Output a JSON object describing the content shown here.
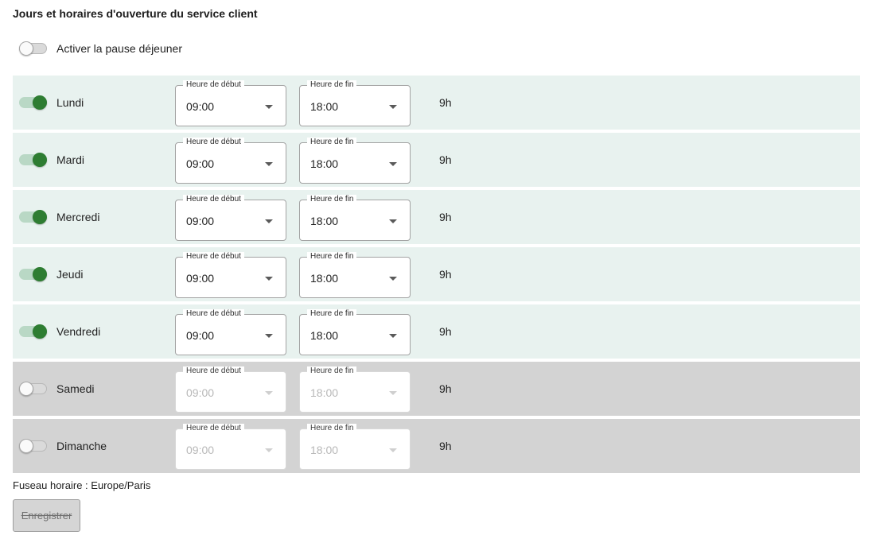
{
  "header": {
    "title": "Jours et horaires d'ouverture du service client"
  },
  "lunch_break": {
    "label": "Activer la pause déjeuner",
    "enabled": false
  },
  "days": [
    {
      "name": "Lundi",
      "enabled": true,
      "start_label": "Heure de début",
      "start": "09:00",
      "end_label": "Heure de fin",
      "end": "18:00",
      "duration": "9h"
    },
    {
      "name": "Mardi",
      "enabled": true,
      "start_label": "Heure de début",
      "start": "09:00",
      "end_label": "Heure de fin",
      "end": "18:00",
      "duration": "9h"
    },
    {
      "name": "Mercredi",
      "enabled": true,
      "start_label": "Heure de début",
      "start": "09:00",
      "end_label": "Heure de fin",
      "end": "18:00",
      "duration": "9h"
    },
    {
      "name": "Jeudi",
      "enabled": true,
      "start_label": "Heure de début",
      "start": "09:00",
      "end_label": "Heure de fin",
      "end": "18:00",
      "duration": "9h"
    },
    {
      "name": "Vendredi",
      "enabled": true,
      "start_label": "Heure de début",
      "start": "09:00",
      "end_label": "Heure de fin",
      "end": "18:00",
      "duration": "9h"
    },
    {
      "name": "Samedi",
      "enabled": false,
      "start_label": "Heure de début",
      "start": "09:00",
      "end_label": "Heure de fin",
      "end": "18:00",
      "duration": "9h"
    },
    {
      "name": "Dimanche",
      "enabled": false,
      "start_label": "Heure de début",
      "start": "09:00",
      "end_label": "Heure de fin",
      "end": "18:00",
      "duration": "9h"
    }
  ],
  "footer": {
    "timezone": "Fuseau horaire : Europe/Paris",
    "save_label": "Enregistrer"
  },
  "colors": {
    "accent_green": "#2e7d32",
    "open_row_bg": "#e8f2ef",
    "closed_row_bg": "#d3d3d3"
  },
  "icons": {
    "select_caret": "caret-down-icon",
    "toggle": "toggle-switch"
  }
}
